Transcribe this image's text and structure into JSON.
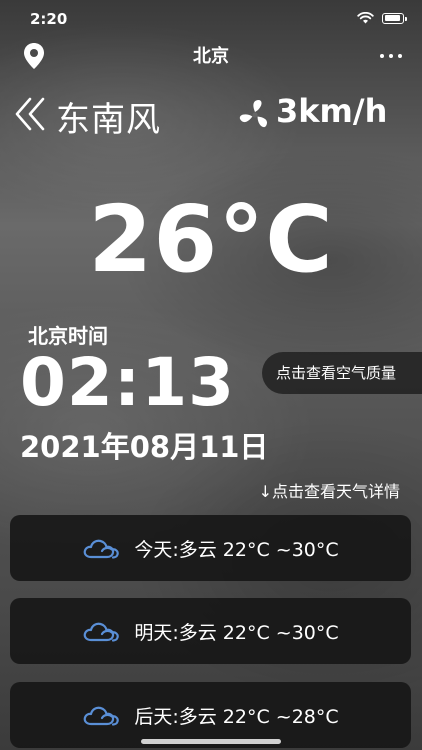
{
  "status_bar": {
    "time": "2:20"
  },
  "nav": {
    "title": "北京"
  },
  "wind": {
    "direction": "东南风",
    "speed": "3km/h"
  },
  "temperature": "26°C",
  "clock": {
    "label": "北京时间",
    "time": "02:13",
    "date": "2021年08月11日"
  },
  "air_quality_button": "点击查看空气质量",
  "detail_link": "↓点击查看天气详情",
  "forecast": [
    {
      "label": "今天:多云 22°C ~30°C",
      "icon": "cloud-icon"
    },
    {
      "label": "明天:多云 22°C ~30°C",
      "icon": "cloud-icon"
    },
    {
      "label": "后天:多云 22°C ~28°C",
      "icon": "cloud-icon"
    }
  ],
  "colors": {
    "card_bg": "#161616",
    "cloud_icon": "#5a8fd6",
    "text": "#ffffff"
  }
}
